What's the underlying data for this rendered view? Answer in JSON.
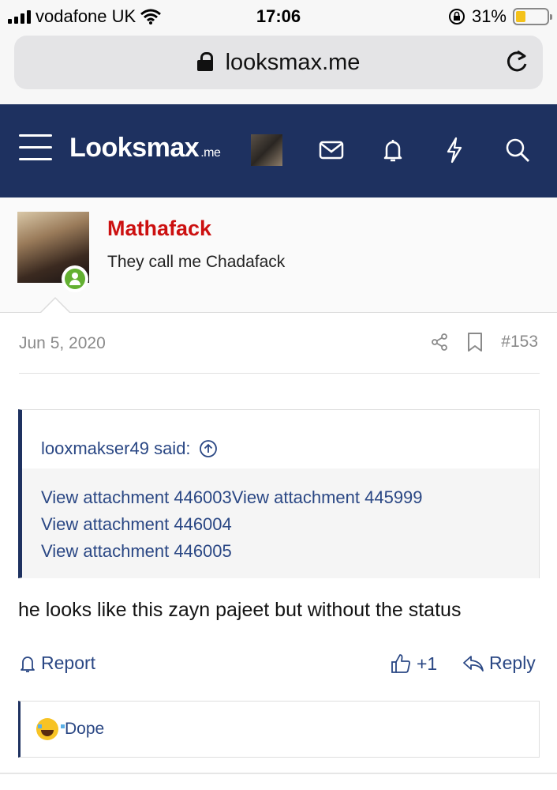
{
  "status_bar": {
    "carrier": "vodafone UK",
    "time": "17:06",
    "battery_percent": "31%",
    "battery_level": 0.31
  },
  "browser": {
    "url": "looksmax.me"
  },
  "site_header": {
    "logo_main": "Looksmax",
    "logo_suffix": ".me"
  },
  "post": {
    "username": "Mathafack",
    "user_title": "They call me Chadafack",
    "date": "Jun 5, 2020",
    "post_number": "#153",
    "quote": {
      "author_label": "looxmakser49 said:",
      "lines": [
        "View attachment 446003View attachment 445999",
        "View attachment 446004",
        "View attachment 446005"
      ]
    },
    "message": "he looks like this zayn pajeet but without the status",
    "actions": {
      "report": "Report",
      "like_count": "+1",
      "reply": "Reply"
    },
    "reaction": {
      "label": "Dope"
    }
  },
  "colors": {
    "header_bg": "#1e3160",
    "username": "#cc1010",
    "link": "#2a4784",
    "online": "#63b031",
    "battery": "#f4c21a"
  }
}
